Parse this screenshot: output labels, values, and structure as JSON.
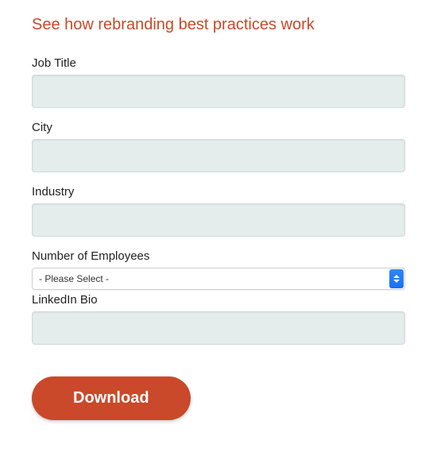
{
  "heading": "See how rebranding best practices work",
  "form": {
    "job_title": {
      "label": "Job Title",
      "value": ""
    },
    "city": {
      "label": "City",
      "value": ""
    },
    "industry": {
      "label": "Industry",
      "value": ""
    },
    "employees": {
      "label": "Number of Employees",
      "selected": "- Please Select -"
    },
    "linkedin": {
      "label": "LinkedIn Bio",
      "value": ""
    }
  },
  "submit_label": "Download"
}
